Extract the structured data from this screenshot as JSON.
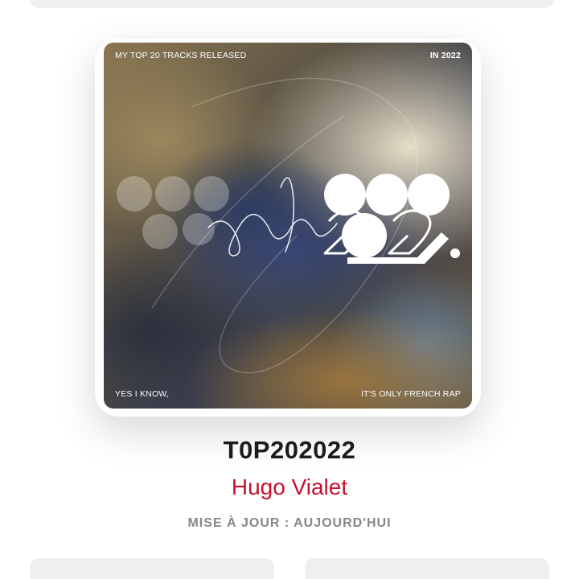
{
  "cover": {
    "top_left_text": "MY TOP 20 TRACKS RELEASED",
    "top_right_text": "IN 2022",
    "bottom_left_text": "YES I KNOW,",
    "bottom_right_text": "IT'S ONLY FRENCH RAP"
  },
  "playlist": {
    "title": "T0P202022",
    "curator": "Hugo Vialet",
    "updated": "MISE À JOUR : AUJOURD'HUI"
  },
  "colors": {
    "accent": "#c8102e",
    "secondary_text": "#86868b",
    "title_text": "#1c1c1e",
    "button_bg": "#efeff1"
  }
}
